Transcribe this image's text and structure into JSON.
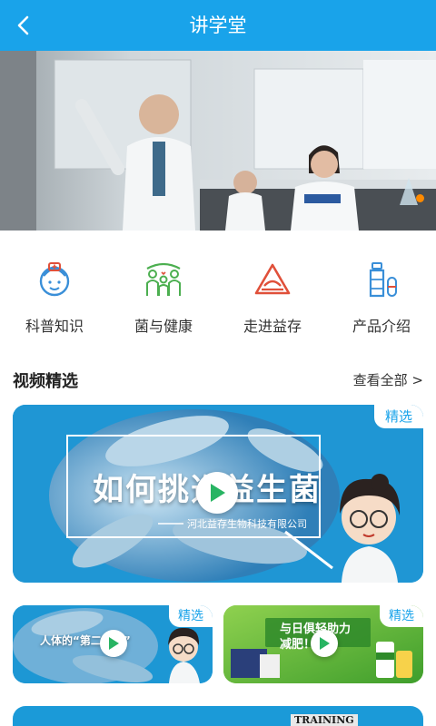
{
  "header": {
    "title": "讲学堂",
    "back_icon": "chevron-left-icon"
  },
  "banner": {
    "alt": "实验室研究人员",
    "active_dot_color": "#ff8a00"
  },
  "menu": [
    {
      "label": "科普知识",
      "icon": "nurse-icon"
    },
    {
      "label": "菌与健康",
      "icon": "family-icon"
    },
    {
      "label": "走进益存",
      "icon": "triangle-logo-icon"
    },
    {
      "label": "产品介绍",
      "icon": "bottle-capsule-icon"
    }
  ],
  "section": {
    "title": "视频精选",
    "see_all": "查看全部 >"
  },
  "videos": {
    "main": {
      "badge": "精选",
      "title": "如何挑选益生菌",
      "subtitle": "河北益存生物科技有限公司"
    },
    "left": {
      "badge": "精选",
      "title": "人体的“第二大脑”"
    },
    "right": {
      "badge": "精选",
      "title": "与日俱轻助力减肥！"
    },
    "bottom_label": "TRAINING"
  },
  "colors": {
    "primary": "#19a3ea",
    "orange": "#ff8a00",
    "icon_blue": "#3a8fd8",
    "icon_green": "#4caf50",
    "icon_red": "#e0503a"
  }
}
